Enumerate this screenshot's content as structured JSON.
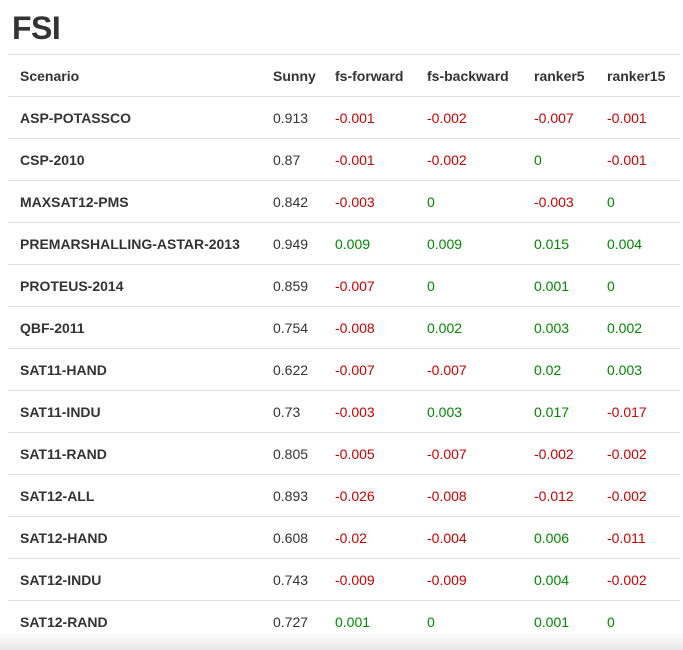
{
  "page": {
    "title": "FSI"
  },
  "table": {
    "headers": [
      "Scenario",
      "Sunny",
      "fs-forward",
      "fs-backward",
      "ranker5",
      "ranker15"
    ],
    "rows": [
      [
        "ASP-POTASSCO",
        "0.913",
        "-0.001",
        "-0.002",
        "-0.007",
        "-0.001"
      ],
      [
        "CSP-2010",
        "0.87",
        "-0.001",
        "-0.002",
        "0",
        "-0.001"
      ],
      [
        "MAXSAT12-PMS",
        "0.842",
        "-0.003",
        "0",
        "-0.003",
        "0"
      ],
      [
        "PREMARSHALLING-ASTAR-2013",
        "0.949",
        "0.009",
        "0.009",
        "0.015",
        "0.004"
      ],
      [
        "PROTEUS-2014",
        "0.859",
        "-0.007",
        "0",
        "0.001",
        "0"
      ],
      [
        "QBF-2011",
        "0.754",
        "-0.008",
        "0.002",
        "0.003",
        "0.002"
      ],
      [
        "SAT11-HAND",
        "0.622",
        "-0.007",
        "-0.007",
        "0.02",
        "0.003"
      ],
      [
        "SAT11-INDU",
        "0.73",
        "-0.003",
        "0.003",
        "0.017",
        "-0.017"
      ],
      [
        "SAT11-RAND",
        "0.805",
        "-0.005",
        "-0.007",
        "-0.002",
        "-0.002"
      ],
      [
        "SAT12-ALL",
        "0.893",
        "-0.026",
        "-0.008",
        "-0.012",
        "-0.002"
      ],
      [
        "SAT12-HAND",
        "0.608",
        "-0.02",
        "-0.004",
        "0.006",
        "-0.011"
      ],
      [
        "SAT12-INDU",
        "0.743",
        "-0.009",
        "-0.009",
        "0.004",
        "-0.002"
      ],
      [
        "SAT12-RAND",
        "0.727",
        "0.001",
        "0",
        "0.001",
        "0"
      ]
    ]
  },
  "colors": {
    "negative": "#cc0000",
    "positive": "#008800",
    "text": "#333333",
    "border": "#dddddd"
  }
}
